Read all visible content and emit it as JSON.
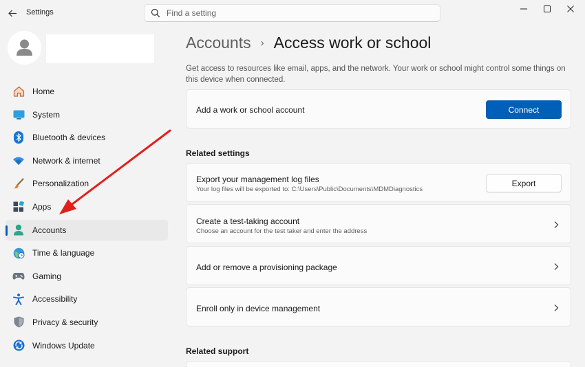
{
  "window": {
    "title": "Settings",
    "controls": {
      "minimize": "minimize-icon",
      "maximize": "maximize-icon",
      "close": "close-icon"
    }
  },
  "search": {
    "placeholder": "Find a setting",
    "value": ""
  },
  "sidebar": {
    "items": [
      {
        "label": "Home",
        "icon": "home-icon"
      },
      {
        "label": "System",
        "icon": "system-icon"
      },
      {
        "label": "Bluetooth & devices",
        "icon": "bluetooth-icon"
      },
      {
        "label": "Network & internet",
        "icon": "wifi-icon"
      },
      {
        "label": "Personalization",
        "icon": "brush-icon"
      },
      {
        "label": "Apps",
        "icon": "apps-icon"
      },
      {
        "label": "Accounts",
        "icon": "accounts-icon",
        "active": true
      },
      {
        "label": "Time & language",
        "icon": "globe-clock-icon"
      },
      {
        "label": "Gaming",
        "icon": "gamepad-icon"
      },
      {
        "label": "Accessibility",
        "icon": "accessibility-icon"
      },
      {
        "label": "Privacy & security",
        "icon": "shield-icon"
      },
      {
        "label": "Windows Update",
        "icon": "update-icon"
      }
    ]
  },
  "main": {
    "breadcrumb": {
      "parent": "Accounts",
      "separator": "›",
      "current": "Access work or school"
    },
    "description": "Get access to resources like email, apps, and the network. Your work or school might control some things on this device when connected.",
    "add_account": {
      "title": "Add a work or school account",
      "button": "Connect"
    },
    "related_settings": {
      "heading": "Related settings",
      "items": [
        {
          "title": "Export your management log files",
          "subtitle": "Your log files will be exported to: C:\\Users\\Public\\Documents\\MDMDiagnostics",
          "button": "Export"
        },
        {
          "title": "Create a test-taking account",
          "subtitle": "Choose an account for the test taker and enter the address"
        },
        {
          "title": "Add or remove a provisioning package"
        },
        {
          "title": "Enroll only in device management"
        }
      ]
    },
    "related_support": {
      "heading": "Related support"
    }
  },
  "colors": {
    "accent": "#005fb8",
    "annotation": "#e0201b",
    "background": "#f3f3f3",
    "card": "#fbfbfb"
  }
}
